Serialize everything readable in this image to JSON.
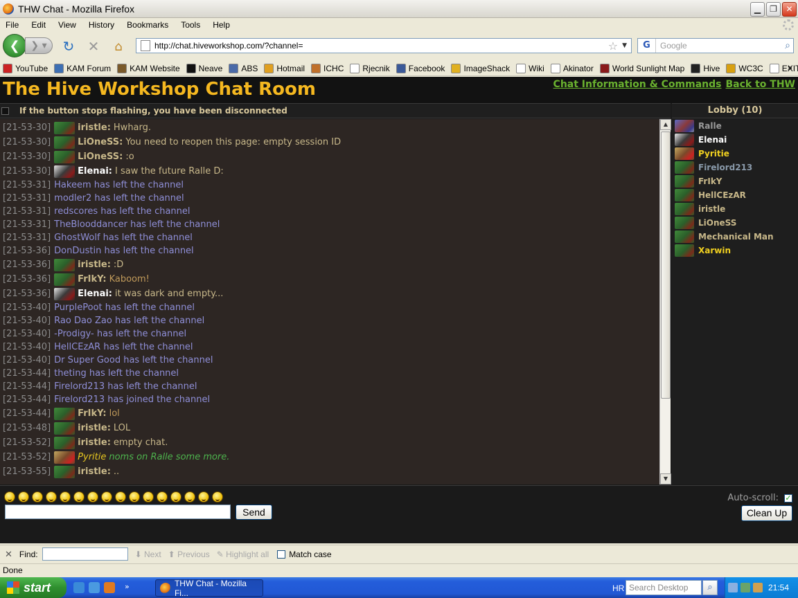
{
  "window": {
    "title": "THW Chat - Mozilla Firefox"
  },
  "menu": [
    "File",
    "Edit",
    "View",
    "History",
    "Bookmarks",
    "Tools",
    "Help"
  ],
  "nav": {
    "url": "http://chat.hiveworkshop.com/?channel=",
    "search_placeholder": "Google"
  },
  "bookmarks": [
    {
      "label": "YouTube",
      "color": "#cc2222"
    },
    {
      "label": "KAM Forum",
      "color": "#3d6fb3"
    },
    {
      "label": "KAM Website",
      "color": "#7a5a2a"
    },
    {
      "label": "Neave",
      "color": "#111111"
    },
    {
      "label": "ABS",
      "color": "#4a6aa8"
    },
    {
      "label": "Hotmail",
      "color": "#e0a020"
    },
    {
      "label": "ICHC",
      "color": "#c0702a"
    },
    {
      "label": "Rjecnik",
      "color": "#ffffff"
    },
    {
      "label": "Facebook",
      "color": "#3b5998"
    },
    {
      "label": "ImageShack",
      "color": "#e0b020"
    },
    {
      "label": "Wiki",
      "color": "#ffffff"
    },
    {
      "label": "Akinator",
      "color": "#ffffff"
    },
    {
      "label": "World Sunlight Map",
      "color": "#8a1a1a"
    },
    {
      "label": "Hive",
      "color": "#222222"
    },
    {
      "label": "WC3C",
      "color": "#d8a010"
    },
    {
      "label": "EXIT MUNDI",
      "color": "#ffffff"
    }
  ],
  "chat": {
    "title": "The Hive Workshop Chat Room",
    "link_info": "Chat Information & Commands",
    "link_back": "Back to THW",
    "status_msg": "If the button stops flashing, you have been disconnected",
    "lobby_title": "Lobby (10)",
    "messages": [
      {
        "ts": "[21-53-30]",
        "user": "iristle:",
        "text": "Hwharg.",
        "av": "orc",
        "ucolor": "#c8b88a",
        "tcolor": "#c8b88a"
      },
      {
        "ts": "[21-53-30]",
        "user": "LiOneSS:",
        "text": "You need to reopen this page: empty session ID",
        "av": "orc",
        "ucolor": "#c8b88a",
        "tcolor": "#c8b88a"
      },
      {
        "ts": "[21-53-30]",
        "user": "LiOneSS:",
        "text": ":o",
        "av": "orc",
        "ucolor": "#c8b88a",
        "tcolor": "#c8b88a"
      },
      {
        "ts": "[21-53-30]",
        "user": "Elenai:",
        "text": "I saw the future Ralle D:",
        "av": "elenai",
        "ucolor": "#ffffff",
        "tcolor": "#c8b88a"
      },
      {
        "ts": "[21-53-31]",
        "sys": "Hakeem has left the channel"
      },
      {
        "ts": "[21-53-31]",
        "sys": "modler2 has left the channel"
      },
      {
        "ts": "[21-53-31]",
        "sys": "redscores has left the channel"
      },
      {
        "ts": "[21-53-31]",
        "sys": "TheBlooddancer has left the channel"
      },
      {
        "ts": "[21-53-31]",
        "sys": "GhostWolf has left the channel"
      },
      {
        "ts": "[21-53-36]",
        "sys": "DonDustin has left the channel"
      },
      {
        "ts": "[21-53-36]",
        "user": "iristle:",
        "text": ":D",
        "av": "orc",
        "ucolor": "#c8b88a",
        "tcolor": "#c8b88a"
      },
      {
        "ts": "[21-53-36]",
        "user": "FrIkY:",
        "text": "Kaboom!",
        "av": "orc",
        "ucolor": "#c8b88a",
        "tcolor": "#c09a5a"
      },
      {
        "ts": "[21-53-36]",
        "user": "Elenai:",
        "text": "it was dark and empty...",
        "av": "elenai",
        "ucolor": "#ffffff",
        "tcolor": "#c8b88a"
      },
      {
        "ts": "[21-53-40]",
        "sys": "PurplePoot has left the channel"
      },
      {
        "ts": "[21-53-40]",
        "sys": "Rao Dao Zao has left the channel"
      },
      {
        "ts": "[21-53-40]",
        "sys": "-Prodigy- has left the channel"
      },
      {
        "ts": "[21-53-40]",
        "sys": "HellCEzAR has left the channel"
      },
      {
        "ts": "[21-53-40]",
        "sys": "Dr Super Good has left the channel"
      },
      {
        "ts": "[21-53-44]",
        "sys": "theting has left the channel"
      },
      {
        "ts": "[21-53-44]",
        "sys": "Firelord213 has left the channel"
      },
      {
        "ts": "[21-53-44]",
        "sys": "Firelord213 has joined the channel"
      },
      {
        "ts": "[21-53-44]",
        "user": "FrIkY:",
        "text": "lol",
        "av": "orc",
        "ucolor": "#c8b88a",
        "tcolor": "#c09a5a"
      },
      {
        "ts": "[21-53-48]",
        "user": "iristle:",
        "text": "LOL",
        "av": "orc",
        "ucolor": "#c8b88a",
        "tcolor": "#c8b88a"
      },
      {
        "ts": "[21-53-52]",
        "user": "iristle:",
        "text": "empty chat.",
        "av": "orc",
        "ucolor": "#c8b88a",
        "tcolor": "#c8b88a"
      },
      {
        "ts": "[21-53-52]",
        "user": "Pyritie",
        "text": "noms on Ralle some more.",
        "av": "pyritie",
        "ucolor": "#e8c820",
        "tcolor": "#4db34d",
        "emote": true
      },
      {
        "ts": "[21-53-55]",
        "user": "iristle:",
        "text": "..",
        "av": "orc",
        "ucolor": "#c8b88a",
        "tcolor": "#c8b88a"
      }
    ],
    "lobby": [
      {
        "name": "Ralle",
        "color": "#9a9a9a",
        "av": "ralle"
      },
      {
        "name": "Elenai",
        "color": "#ffffff",
        "av": "elenai"
      },
      {
        "name": "Pyritie",
        "color": "#f0d020",
        "av": "pyritie"
      },
      {
        "name": "Firelord213",
        "color": "#8a9aaa",
        "av": "orc"
      },
      {
        "name": "FrIkY",
        "color": "#c8b88a",
        "av": "orc"
      },
      {
        "name": "HellCEzAR",
        "color": "#c8b88a",
        "av": "orc"
      },
      {
        "name": "iristle",
        "color": "#c8b88a",
        "av": "orc"
      },
      {
        "name": "LiOneSS",
        "color": "#c8b88a",
        "av": "orc"
      },
      {
        "name": "Mechanical Man",
        "color": "#c8b88a",
        "av": "orc"
      },
      {
        "name": "Xarwin",
        "color": "#f0d020",
        "av": "orc"
      }
    ],
    "send_label": "Send",
    "autoscroll_label": "Auto-scroll:",
    "cleanup_label": "Clean Up",
    "smiley_count": 16
  },
  "find": {
    "label": "Find:",
    "next": "Next",
    "previous": "Previous",
    "highlight": "Highlight all",
    "match_case": "Match case"
  },
  "status": "Done",
  "taskbar": {
    "start": "start",
    "task": "THW Chat - Mozilla Fi...",
    "lang": "HR",
    "search": "Search Desktop",
    "clock": "21:54"
  }
}
